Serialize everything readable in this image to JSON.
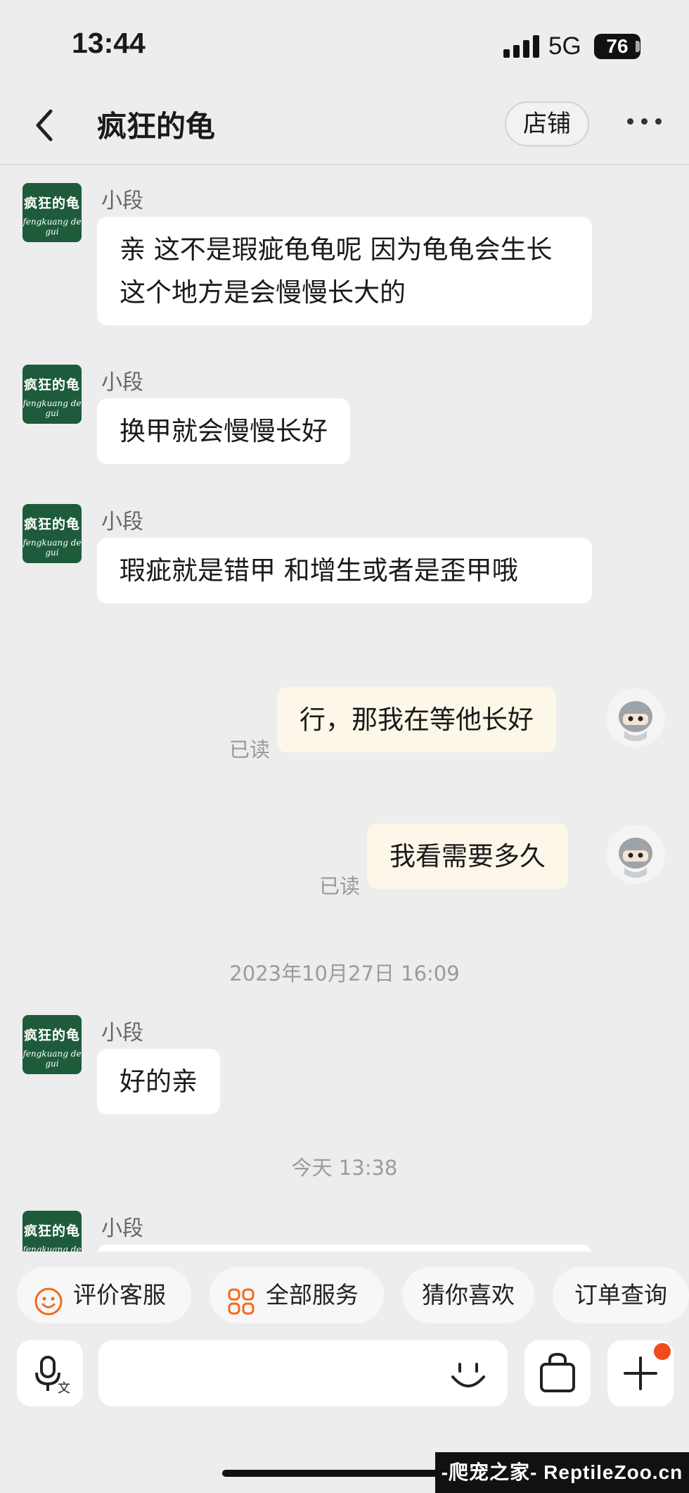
{
  "status": {
    "time": "13:44",
    "network": "5G",
    "battery": "76"
  },
  "nav": {
    "title": "疯狂的龟",
    "shop_label": "店铺"
  },
  "shop_avatar": {
    "line1": "疯狂的龟",
    "line2": "fengkuang de gui"
  },
  "messages": [
    {
      "sender": "小段",
      "text": "亲 这不是瑕疵龟龟呢 因为龟龟会生长  这个地方是会慢慢长大的"
    },
    {
      "sender": "小段",
      "text": "换甲就会慢慢长好"
    },
    {
      "sender": "小段",
      "text": "瑕疵就是错甲 和增生或者是歪甲哦"
    },
    {
      "text": "行，那我在等他长好",
      "status": "已读"
    },
    {
      "text": "我看需要多久",
      "status": "已读"
    },
    {
      "timestamp": "2023年10月27日 16:09"
    },
    {
      "sender": "小段",
      "text": "好的亲"
    },
    {
      "timestamp": "今天 13:38"
    },
    {
      "sender": "小段",
      "text": ""
    }
  ],
  "quick_actions": [
    "评价客服",
    "全部服务",
    "猜你喜欢",
    "订单查询"
  ],
  "input": {
    "placeholder": ""
  },
  "watermark": "-爬宠之家- ReptileZoo.cn",
  "colors": {
    "avatar_green": "#1d5b3a",
    "mine_bubble": "#fdf7e9",
    "accent": "#f26a1b",
    "notification": "#f24a1a"
  }
}
